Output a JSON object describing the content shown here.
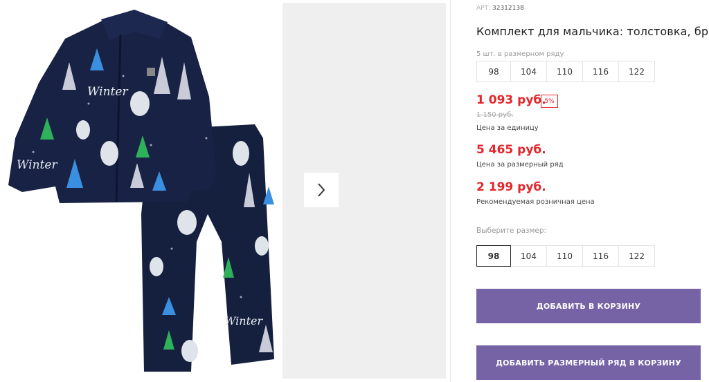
{
  "gallery": {
    "next_icon": "chevron-right-icon",
    "photo_text": "Winter"
  },
  "product": {
    "sku_label": "АРТ:",
    "sku_value": "32312138",
    "title": "Комплект для мальчика: толстовка, брюки",
    "pack_note": "5 шт. в размерном ряду",
    "row_sizes": [
      "98",
      "104",
      "110",
      "116",
      "122"
    ],
    "price_unit": "1 093 руб.",
    "discount_badge": "5%",
    "old_price": "1 150 руб.",
    "price_unit_caption": "Цена за единицу",
    "price_row": "5 465 руб.",
    "price_row_caption": "Цена за размерный ряд",
    "price_retail": "2 199 руб.",
    "price_retail_caption": "Рекомендуемая розничная цена",
    "choose_size_label": "Выберите размер:",
    "size_options": [
      "98",
      "104",
      "110",
      "116",
      "122"
    ],
    "selected_size": "98",
    "add_to_cart_label": "ДОБАВИТЬ В КОРЗИНУ",
    "add_row_to_cart_label": "ДОБАВИТЬ РАЗМЕРНЫЙ РЯД В КОРЗИНУ"
  },
  "colors": {
    "accent": "#7563a6",
    "price": "#e2262b",
    "fabric": "#15203f"
  }
}
